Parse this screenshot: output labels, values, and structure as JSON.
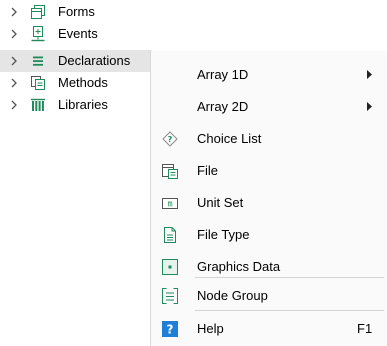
{
  "tree": {
    "items": [
      {
        "label": "Forms",
        "icon": "forms-icon"
      },
      {
        "label": "Events",
        "icon": "events-icon"
      },
      {
        "label": "Declarations",
        "icon": "declarations-icon"
      },
      {
        "label": "Methods",
        "icon": "methods-icon"
      },
      {
        "label": "Libraries",
        "icon": "libraries-icon"
      }
    ],
    "selected": "Declarations"
  },
  "context_menu": {
    "items": [
      {
        "label": "Array 1D",
        "submenu": true
      },
      {
        "label": "Array 2D",
        "submenu": true
      },
      {
        "label": "Choice List",
        "icon": "choice-list-icon"
      },
      {
        "label": "File",
        "icon": "file-icon"
      },
      {
        "label": "Unit Set",
        "icon": "unit-set-icon",
        "icon_text": "m"
      },
      {
        "label": "File Type",
        "icon": "file-type-icon"
      },
      {
        "label": "Graphics Data",
        "icon": "graphics-data-icon"
      },
      {
        "label": "Node Group",
        "icon": "node-group-icon"
      },
      {
        "label": "Help",
        "icon": "help-icon",
        "icon_text": "?",
        "shortcut": "F1"
      }
    ]
  },
  "colors": {
    "accent_green": "#1f8a5a",
    "help_blue": "#1f7fd6",
    "selection": "#e5e5e5",
    "menu_bg": "#fafafa"
  }
}
